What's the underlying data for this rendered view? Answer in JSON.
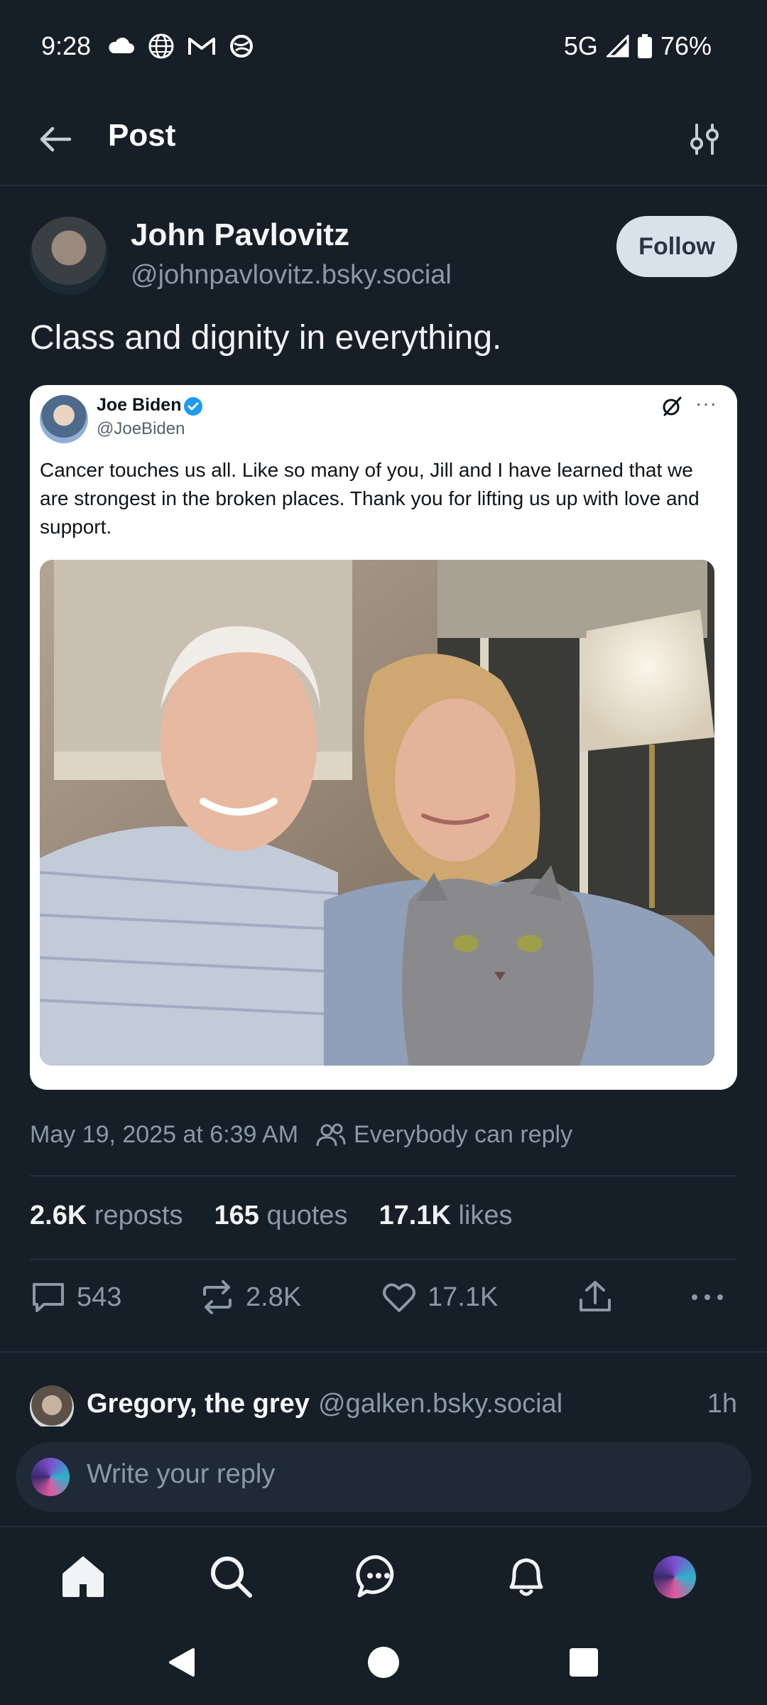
{
  "status_bar": {
    "time": "9:28",
    "network": "5G",
    "battery": "76%"
  },
  "header": {
    "title": "Post"
  },
  "post": {
    "author_name": "John Pavlovitz",
    "author_handle": "@johnpavlovitz.bsky.social",
    "follow_label": "Follow",
    "text": "Class and dignity in everything.",
    "embed": {
      "name": "Joe Biden",
      "handle": "@JoeBiden",
      "text": "Cancer touches us all. Like so many of you, Jill and I have learned that we are strongest in the broken places. Thank you for lifting us up with love and support.",
      "more": "···"
    },
    "timestamp": "May 19, 2025 at 6:39 AM",
    "reply_setting": "Everybody can reply",
    "stats": {
      "reposts_count": "2.6K",
      "reposts_label": "reposts",
      "quotes_count": "165",
      "quotes_label": "quotes",
      "likes_count": "17.1K",
      "likes_label": "likes"
    },
    "actions": {
      "replies": "543",
      "reposts": "2.8K",
      "likes": "17.1K"
    }
  },
  "reply_preview": {
    "name": "Gregory, the grey",
    "handle": "@galken.bsky.social",
    "time": "1h"
  },
  "composer": {
    "placeholder": "Write your reply"
  },
  "colors": {
    "background": "#161e27",
    "muted": "#8b98a5",
    "divider": "#232e3a",
    "follow_bg": "#d9e1ea",
    "verified": "#1d9bf0"
  },
  "icons": {
    "status": [
      "cloud-icon",
      "globe-icon",
      "gmail-icon",
      "vpn-icon",
      "signal-icon",
      "battery-icon"
    ],
    "header": [
      "back-arrow-icon",
      "tune-icon"
    ],
    "actions": [
      "reply-icon",
      "repost-icon",
      "like-icon",
      "share-icon",
      "more-icon"
    ],
    "tabs": [
      "home-icon",
      "search-icon",
      "chat-icon",
      "bell-icon",
      "profile-avatar"
    ],
    "nav": [
      "back-triangle-icon",
      "home-circle-icon",
      "recents-square-icon"
    ]
  }
}
